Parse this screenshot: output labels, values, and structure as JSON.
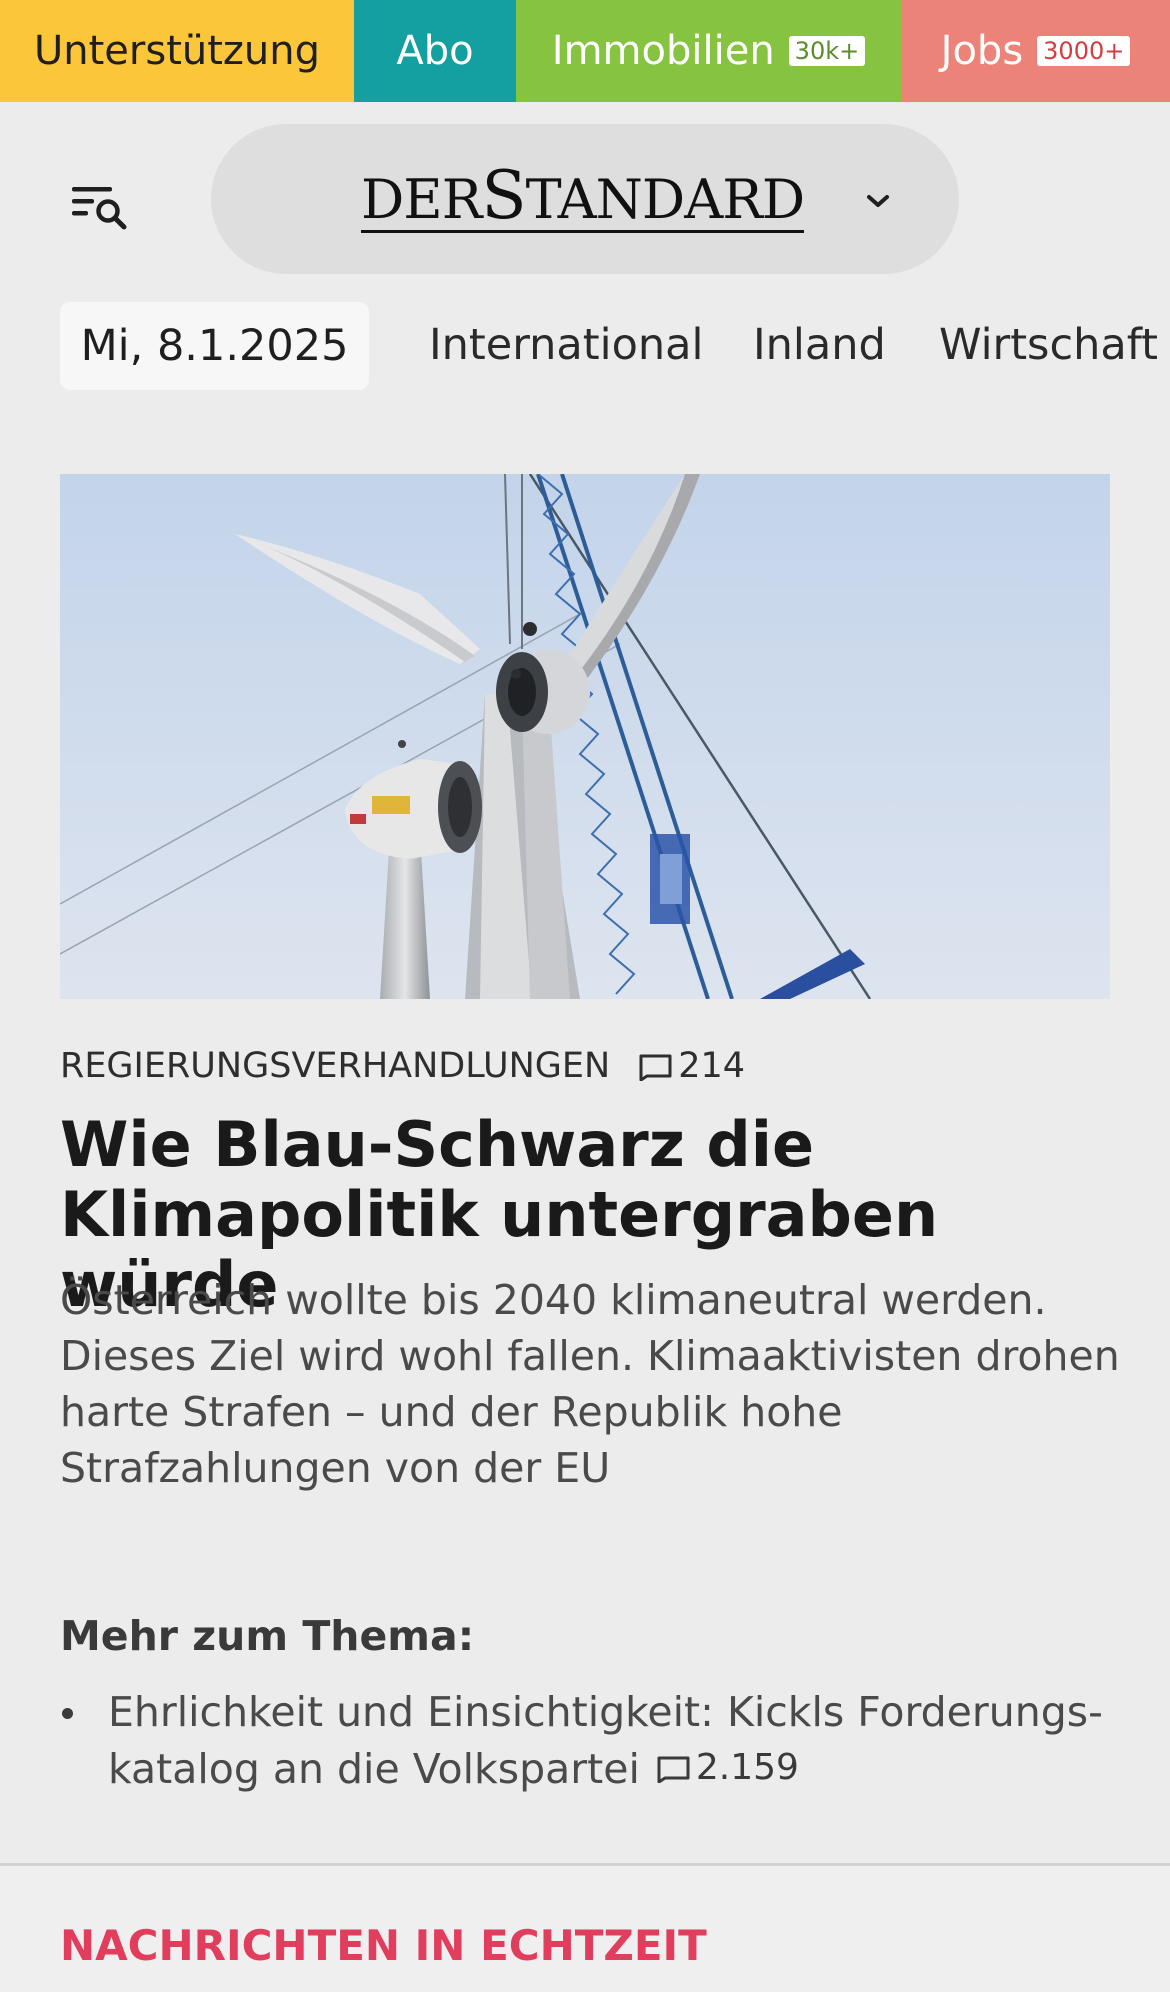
{
  "topnav": {
    "support": "Unterstützung",
    "abo": "Abo",
    "immobilien": "Immobilien",
    "immobilien_badge": "30k+",
    "jobs": "Jobs",
    "jobs_badge": "3000+"
  },
  "header": {
    "logo_prefix": "DER",
    "logo_s": "S",
    "logo_rest": "TANDARD",
    "menu_icon": "menu-search-icon",
    "dropdown_icon": "chevron-down-icon"
  },
  "secnav": {
    "date": "Mi, 8.1.2025",
    "sections": [
      "International",
      "Inland",
      "Wirtschaft"
    ]
  },
  "article": {
    "kicker": "REGIERUNGSVERHANDLUNGEN",
    "comments": "214",
    "headline": "Wie Blau-Schwarz die Klimapolitik untergraben würde",
    "teaser": "Österreich wollte bis 2040 klimaneutral werden. Dieses Ziel wird wohl fallen. Klimaaktivisten drohen harte Strafen – und der Republik hohe Strafzahlungen von der EU"
  },
  "more": {
    "heading": "Mehr zum Thema:",
    "items": [
      {
        "text": "Ehrlichkeit und Einsichtigkeit: Kickls Forderungs­katalog an die Volkspartei",
        "comments": "2.159"
      }
    ]
  },
  "realtime": {
    "label": "NACHRICHTEN IN ECHTZEIT"
  },
  "colors": {
    "support": "#fcc63a",
    "abo": "#14a0a0",
    "immobilien": "#85c341",
    "jobs": "#ec8378",
    "realtime_accent": "#e13d5c",
    "background": "#ececec"
  }
}
